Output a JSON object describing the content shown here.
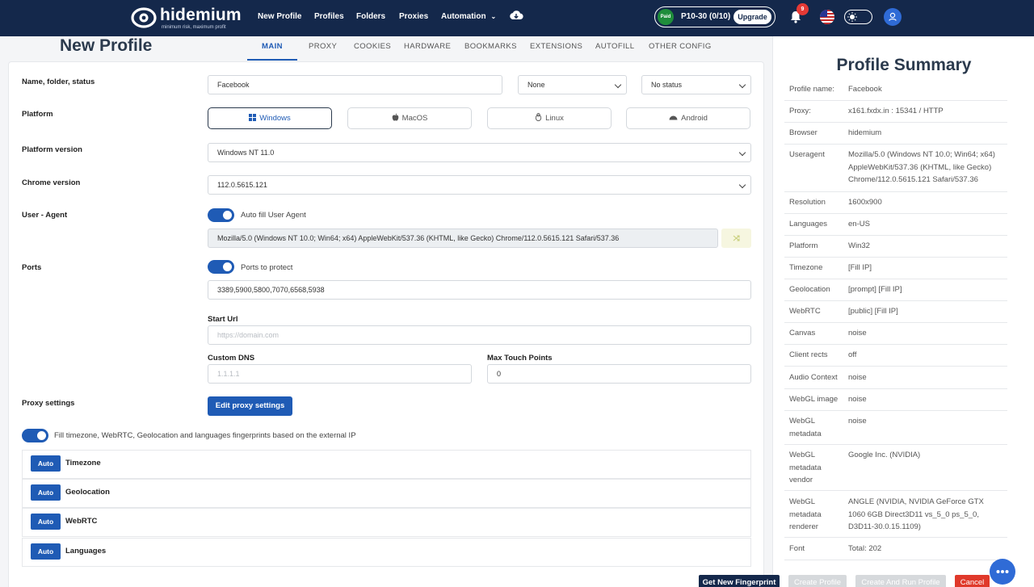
{
  "brand": {
    "name": "hidemium",
    "tagline": "minimum risk, maximum profit"
  },
  "nav": {
    "items": [
      "New Profile",
      "Profiles",
      "Folders",
      "Proxies",
      "Automation"
    ]
  },
  "plan": {
    "badge": "Paid",
    "text": "P10-30 (0/10)",
    "upgrade_label": "Upgrade"
  },
  "notifications": {
    "count": "9"
  },
  "page": {
    "title": "New Profile"
  },
  "tabs": [
    "MAIN",
    "PROXY",
    "COOKIES",
    "HARDWARE",
    "BOOKMARKS",
    "EXTENSIONS",
    "AUTOFILL",
    "OTHER CONFIG"
  ],
  "form": {
    "name_label": "Name, folder, status",
    "name_value": "Facebook",
    "folder_value": "None",
    "status_value": "No status",
    "platform_label": "Platform",
    "platforms": [
      "Windows",
      "MacOS",
      "Linux",
      "Android"
    ],
    "platform_version_label": "Platform version",
    "platform_version_value": "Windows NT 11.0",
    "chrome_version_label": "Chrome version",
    "chrome_version_value": "112.0.5615.121",
    "user_agent_label": "User - Agent",
    "auto_fill_label": "Auto fill User Agent",
    "user_agent_value": "Mozilla/5.0 (Windows NT 10.0; Win64; x64) AppleWebKit/537.36 (KHTML, like Gecko) Chrome/112.0.5615.121 Safari/537.36",
    "ports_label": "Ports",
    "ports_toggle_label": "Ports to protect",
    "ports_value": "3389,5900,5800,7070,6568,5938",
    "start_url_label": "Start Url",
    "start_url_placeholder": "https://domain.com",
    "custom_dns_label": "Custom DNS",
    "custom_dns_placeholder": "1.1.1.1",
    "max_touch_label": "Max Touch Points",
    "max_touch_value": "0",
    "proxy_settings_label": "Proxy settings",
    "edit_proxy_label": "Edit proxy settings",
    "fill_fingerprints_label": "Fill timezone, WebRTC, Geolocation and languages fingerprints based on the external IP",
    "auto_label": "Auto",
    "auto_rows": [
      "Timezone",
      "Geolocation",
      "WebRTC",
      "Languages"
    ]
  },
  "summary": {
    "title": "Profile Summary",
    "rows": [
      {
        "key": "Profile name:",
        "value": "Facebook"
      },
      {
        "key": "Proxy:",
        "value": "x161.fxdx.in : 15341 / HTTP"
      },
      {
        "key": "Browser",
        "value": "hidemium"
      },
      {
        "key": "Useragent",
        "value": "Mozilla/5.0 (Windows NT 10.0; Win64; x64) AppleWebKit/537.36 (KHTML, like Gecko) Chrome/112.0.5615.121 Safari/537.36"
      },
      {
        "key": "Resolution",
        "value": "1600x900"
      },
      {
        "key": "Languages",
        "value": "en-US"
      },
      {
        "key": "Platform",
        "value": "Win32"
      },
      {
        "key": "Timezone",
        "value": "[Fill IP]"
      },
      {
        "key": "Geolocation",
        "value": "[prompt] [Fill IP]"
      },
      {
        "key": "WebRTC",
        "value": "[public] [Fill IP]"
      },
      {
        "key": "Canvas",
        "value": "noise"
      },
      {
        "key": "Client rects",
        "value": "off"
      },
      {
        "key": "Audio Context",
        "value": "noise"
      },
      {
        "key": "WebGL image",
        "value": "noise"
      },
      {
        "key": "WebGL metadata",
        "value": "noise"
      },
      {
        "key": "WebGL metadata vendor",
        "value": "Google Inc. (NVIDIA)"
      },
      {
        "key": "WebGL metadata renderer",
        "value": "ANGLE (NVIDIA, NVIDIA GeForce GTX 1060 6GB Direct3D11 vs_5_0 ps_5_0, D3D11-30.0.15.1109)"
      },
      {
        "key": "Font",
        "value": "Total: 202"
      }
    ]
  },
  "actions": {
    "fingerprint": "Get New Fingerprint",
    "create": "Create Profile",
    "create_run": "Create And Run Profile",
    "cancel": "Cancel"
  },
  "colors": {
    "navy": "#14284b",
    "primary": "#1f5bb5",
    "danger": "#e0392b",
    "paid": "#1f8d3b"
  }
}
